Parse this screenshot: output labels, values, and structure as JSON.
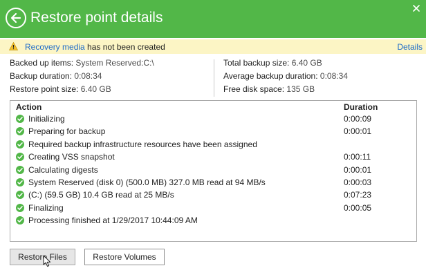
{
  "header": {
    "title": "Restore point details"
  },
  "warning": {
    "link_text": "Recovery media",
    "message": " has not been created",
    "details_label": "Details"
  },
  "info": {
    "left": [
      {
        "label": "Backed up items:",
        "value": "System Reserved:C:\\"
      },
      {
        "label": "Backup duration:",
        "value": "0:08:34"
      },
      {
        "label": "Restore point size:",
        "value": "6.40 GB"
      }
    ],
    "right": [
      {
        "label": "Total backup size:",
        "value": "6.40 GB"
      },
      {
        "label": "Average backup duration:",
        "value": "0:08:34"
      },
      {
        "label": "Free disk space:",
        "value": "135 GB"
      }
    ]
  },
  "actions": {
    "col_action": "Action",
    "col_duration": "Duration",
    "rows": [
      {
        "text": "Initializing",
        "duration": "0:00:09"
      },
      {
        "text": "Preparing for backup",
        "duration": "0:00:01"
      },
      {
        "text": "Required backup infrastructure resources have been assigned",
        "duration": ""
      },
      {
        "text": "Creating VSS snapshot",
        "duration": "0:00:11"
      },
      {
        "text": "Calculating digests",
        "duration": "0:00:01"
      },
      {
        "text": "System Reserved (disk 0) (500.0 MB) 327.0 MB read at 94 MB/s",
        "duration": "0:00:03"
      },
      {
        "text": " (C:) (59.5 GB) 10.4 GB read at 25 MB/s",
        "duration": "0:07:23"
      },
      {
        "text": "Finalizing",
        "duration": "0:00:05"
      },
      {
        "text": "Processing finished at 1/29/2017 10:44:09 AM",
        "duration": ""
      }
    ]
  },
  "buttons": {
    "restore_files": "Restore Files",
    "restore_volumes": "Restore Volumes"
  },
  "colors": {
    "header_green": "#52b748",
    "warning_bg": "#fcf5c5",
    "link_blue": "#1b6ac9",
    "success_green": "#52b748"
  },
  "icons": {
    "back": "back-arrow-icon",
    "close": "close-icon",
    "warning": "warning-icon",
    "success": "check-circle-icon",
    "cursor": "mouse-pointer-icon"
  }
}
